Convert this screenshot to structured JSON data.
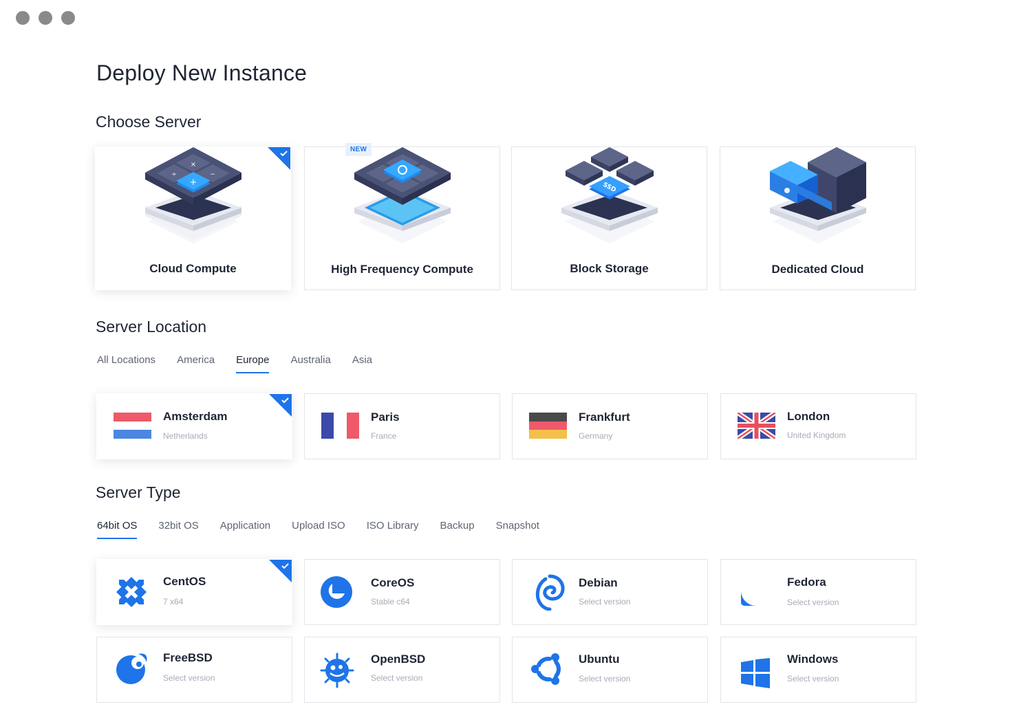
{
  "page_title": "Deploy New Instance",
  "sections": {
    "server": "Choose Server",
    "location": "Server Location",
    "type": "Server Type"
  },
  "servers": [
    {
      "label": "Cloud Compute",
      "selected": true
    },
    {
      "label": "High Frequency Compute",
      "badge": "NEW",
      "selected": false
    },
    {
      "label": "Block Storage",
      "selected": false
    },
    {
      "label": "Dedicated Cloud",
      "selected": false
    }
  ],
  "location_tabs": [
    "All Locations",
    "America",
    "Europe",
    "Australia",
    "Asia"
  ],
  "location_active": "Europe",
  "locations": [
    {
      "city": "Amsterdam",
      "country": "Netherlands",
      "selected": true
    },
    {
      "city": "Paris",
      "country": "France",
      "selected": false
    },
    {
      "city": "Frankfurt",
      "country": "Germany",
      "selected": false
    },
    {
      "city": "London",
      "country": "United Kingdom",
      "selected": false
    }
  ],
  "type_tabs": [
    "64bit OS",
    "32bit OS",
    "Application",
    "Upload ISO",
    "ISO Library",
    "Backup",
    "Snapshot"
  ],
  "type_active": "64bit OS",
  "os": [
    {
      "name": "CentOS",
      "version": "7 x64",
      "icon": "centos-icon",
      "selected": true
    },
    {
      "name": "CoreOS",
      "version": "Stable c64",
      "icon": "coreos-icon",
      "selected": false
    },
    {
      "name": "Debian",
      "version": "Select version",
      "icon": "debian-icon",
      "selected": false
    },
    {
      "name": "Fedora",
      "version": "Select version",
      "icon": "fedora-icon",
      "selected": false
    },
    {
      "name": "FreeBSD",
      "version": "Select version",
      "icon": "freebsd-icon",
      "selected": false
    },
    {
      "name": "OpenBSD",
      "version": "Select version",
      "icon": "openbsd-icon",
      "selected": false
    },
    {
      "name": "Ubuntu",
      "version": "Select version",
      "icon": "ubuntu-icon",
      "selected": false
    },
    {
      "name": "Windows",
      "version": "Select version",
      "icon": "windows-icon",
      "selected": false
    }
  ],
  "colors": {
    "accent": "#1e74e8",
    "text": "#1f2535",
    "muted": "#a7abb6",
    "border": "#e1e4ea"
  }
}
